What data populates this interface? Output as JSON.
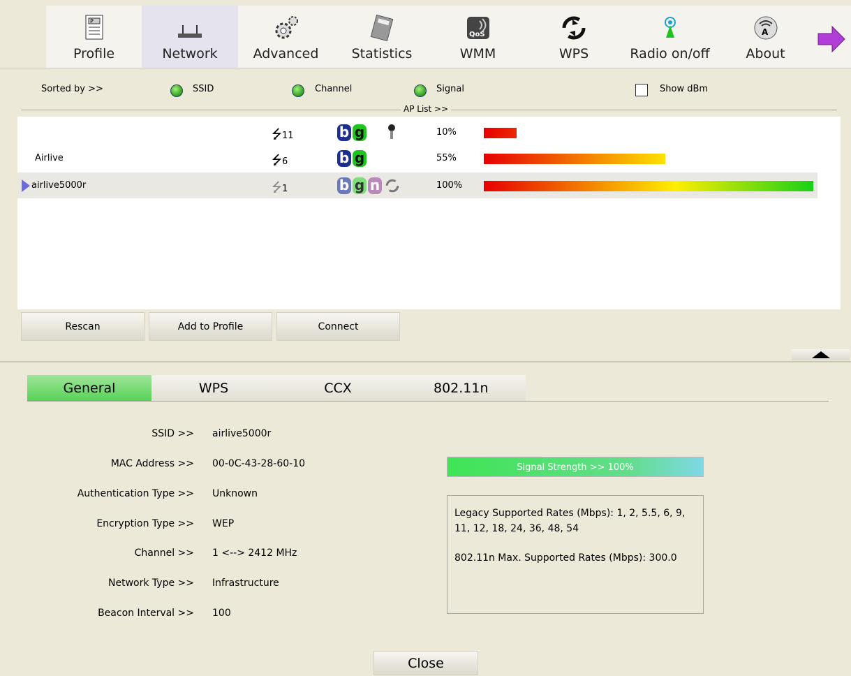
{
  "toolbar": {
    "items": [
      {
        "label": "Profile",
        "icon": "profile-icon"
      },
      {
        "label": "Network",
        "icon": "network-router-icon"
      },
      {
        "label": "Advanced",
        "icon": "gears-icon"
      },
      {
        "label": "Statistics",
        "icon": "calculator-icon"
      },
      {
        "label": "WMM",
        "icon": "qos-icon",
        "icon_text": "QoS"
      },
      {
        "label": "WPS",
        "icon": "wps-icon"
      },
      {
        "label": "Radio on/off",
        "icon": "antenna-icon"
      },
      {
        "label": "About",
        "icon": "about-icon"
      }
    ],
    "next_icon": "next-arrow-icon"
  },
  "sort": {
    "label": "Sorted by >>",
    "options": [
      "SSID",
      "Channel",
      "Signal"
    ],
    "show_dbm": "Show dBm"
  },
  "ap_list_title": "AP List >>",
  "ap_list": [
    {
      "ssid": "",
      "channel": "11",
      "badges": [
        "b",
        "g"
      ],
      "secured": true,
      "signal": "10%",
      "level": 0.1
    },
    {
      "ssid": "Airlive",
      "channel": "6",
      "badges": [
        "b",
        "g"
      ],
      "secured": false,
      "signal": "55%",
      "level": 0.55
    },
    {
      "ssid": "airlive5000r",
      "channel": "1",
      "badges": [
        "b",
        "g",
        "n"
      ],
      "wps": true,
      "signal": "100%",
      "level": 1.0,
      "selected": true
    }
  ],
  "buttons": {
    "rescan": "Rescan",
    "add_profile": "Add to Profile",
    "connect": "Connect",
    "close": "Close"
  },
  "tabs": [
    "General",
    "WPS",
    "CCX",
    "802.11n"
  ],
  "details": {
    "ssid_label": "SSID >>",
    "ssid": "airlive5000r",
    "mac_label": "MAC Address >>",
    "mac": "00-0C-43-28-60-10",
    "auth_label": "Authentication Type >>",
    "auth": "Unknown",
    "enc_label": "Encryption Type >>",
    "enc": "WEP",
    "channel_label": "Channel >>",
    "channel": "1 <--> 2412 MHz",
    "nettype_label": "Network Type >>",
    "nettype": "Infrastructure",
    "beacon_label": "Beacon Interval >>",
    "beacon": "100"
  },
  "signal_strength": "Signal Strength >> 100%",
  "rates": {
    "legacy": "Legacy Supported Rates (Mbps): 1, 2, 5.5, 6, 9, 11, 12, 18, 24, 36, 48, 54",
    "n": "802.11n Max. Supported Rates (Mbps): 300.0"
  },
  "colors": {
    "b_badge": "#1c2f8f",
    "g_badge": "#20c420",
    "n_badge": "#9a4f9a",
    "signal_bar_start": "#e00000",
    "signal_bar_end": "#00d000"
  }
}
